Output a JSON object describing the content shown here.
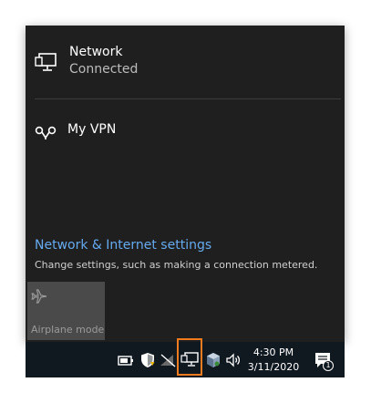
{
  "network": {
    "title": "Network",
    "status": "Connected",
    "icon": "network-pc-icon"
  },
  "vpn": {
    "label": "My VPN",
    "icon": "vpn-icon"
  },
  "settings": {
    "link_label": "Network & Internet settings",
    "description": "Change settings, such as making a connection metered."
  },
  "quick_actions": [
    {
      "label": "Airplane mode",
      "icon": "airplane-icon",
      "state": "off"
    }
  ],
  "taskbar": {
    "tray_icons": [
      "battery-icon",
      "security-shield-icon",
      "wifi-off-icon",
      "network-pc-icon",
      "package-icon",
      "volume-icon"
    ],
    "time": "4:30 PM",
    "date": "3/11/2020",
    "notifications_count": "1"
  },
  "colors": {
    "flyout_bg": "#1f1f1f",
    "taskbar_bg": "#101820",
    "link": "#66aaf0",
    "highlight": "#f07a1e"
  }
}
